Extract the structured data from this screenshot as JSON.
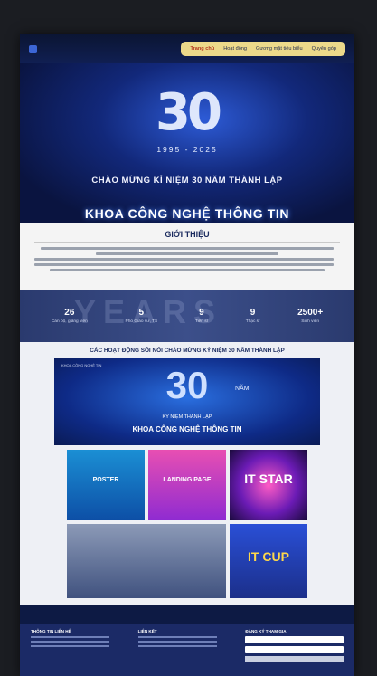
{
  "nav": {
    "items": [
      {
        "label": "Trang chủ",
        "active": true
      },
      {
        "label": "Hoạt động",
        "active": false
      },
      {
        "label": "Gương mặt tiêu biểu",
        "active": false
      },
      {
        "label": "Quyên góp",
        "active": false
      }
    ]
  },
  "hero": {
    "number": "30",
    "years": "1995 - 2025",
    "celebrate": "CHÀO MỪNG KỈ NIỆM 30 NĂM THÀNH LẬP",
    "faculty": "KHOA CÔNG NGHỆ THÔNG TIN"
  },
  "intro": {
    "title": "GIỚI THIỆU"
  },
  "stats": {
    "watermark": "YEARS",
    "items": [
      {
        "num": "26",
        "label": "Cán bộ, giảng viên"
      },
      {
        "num": "5",
        "label": "Phó Giáo sư, TS"
      },
      {
        "num": "9",
        "label": "Tiến sĩ"
      },
      {
        "num": "9",
        "label": "Thạc sĩ"
      },
      {
        "num": "2500+",
        "label": "Sinh viên"
      }
    ]
  },
  "activities": {
    "title": "CÁC HOẠT ĐỘNG SÔI NỔI CHÀO MỪNG KỶ NIỆM 30 NĂM THÀNH LẬP",
    "banner": {
      "number": "30",
      "unit": "NĂM",
      "subtitle": "KỶ NIỆM THÀNH LẬP",
      "name": "KHOA CÔNG NGHỆ THÔNG TIN",
      "header": "KHOA CÔNG NGHỆ TIN"
    },
    "cards": [
      {
        "title": "POSTER"
      },
      {
        "title": "LANDING PAGE"
      },
      {
        "title": "IT STAR"
      },
      {
        "title": ""
      },
      {
        "title": "IT CUP"
      }
    ]
  },
  "footer": {
    "col1": "THÔNG TIN LIÊN HỆ",
    "col2": "LIÊN KẾT",
    "col3": "ĐĂNG KÝ THAM GIA"
  }
}
